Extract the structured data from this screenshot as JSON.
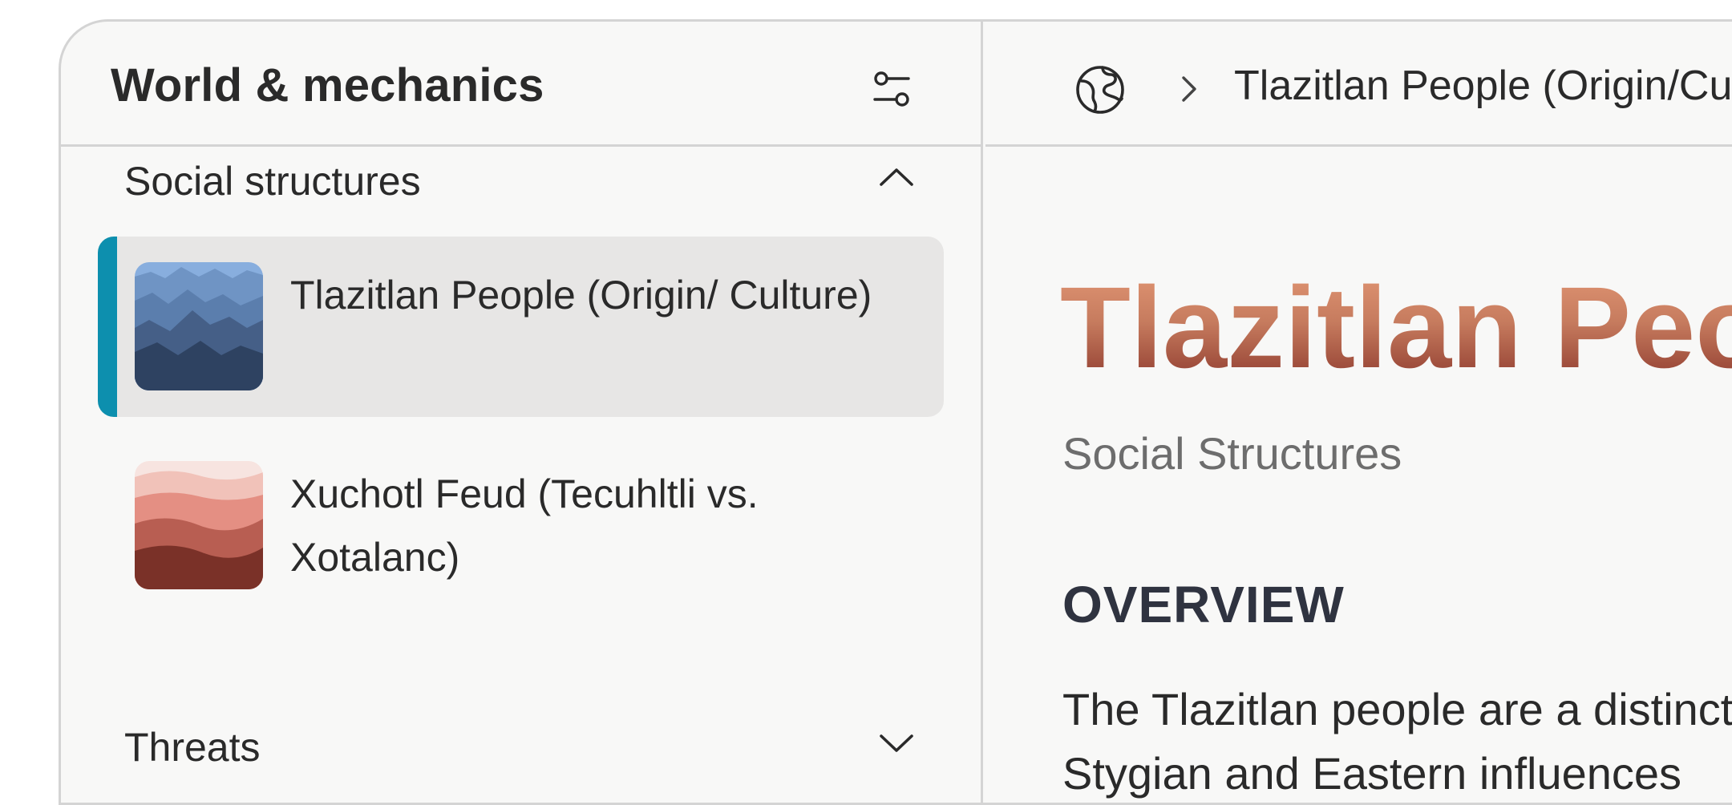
{
  "sidebar": {
    "title": "World & mechanics",
    "sections": [
      {
        "label": "Social structures",
        "expanded": true,
        "items": [
          {
            "label": "Tlazitlan People (Origin/ Culture)",
            "selected": true
          },
          {
            "label": "Xuchotl Feud (Tecuhltli vs. Xotalanc)",
            "selected": false
          }
        ]
      },
      {
        "label": "Threats",
        "expanded": false
      }
    ]
  },
  "breadcrumb": {
    "current": "Tlazitlan People (Origin/Culture)"
  },
  "article": {
    "title": "Tlazitlan People (Origin/Culture)",
    "subtitle": "Social Structures",
    "section_heading": "OVERVIEW",
    "overview_text": [
      "The Tlazitlan people are a distinct population shaped by",
      "Stygian and Eastern influences"
    ]
  },
  "colors": {
    "accent": "#0d8fae",
    "selected_bg": "#e7e6e5",
    "title_gradient_top": "#e09573",
    "title_gradient_bottom": "#8e3a2e"
  },
  "icons": {
    "filter": "sliders-icon",
    "section_open": "chevron-up-icon",
    "section_closed": "chevron-down-icon",
    "breadcrumb_root": "globe-icon",
    "breadcrumb_separator": "chevron-right-icon"
  }
}
